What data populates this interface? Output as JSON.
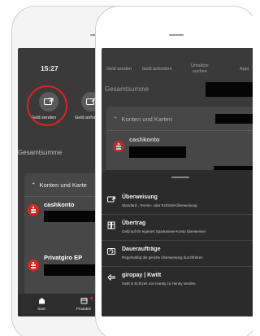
{
  "left_phone": {
    "time": "15:27",
    "actions": [
      {
        "label": "Geld senden",
        "icon": "send-money-icon"
      },
      {
        "label": "Geld anfor",
        "icon": "request-money-icon"
      }
    ],
    "total_label": "Gesamtsumme",
    "accounts_header": "Konten und Karte",
    "accounts": [
      {
        "name": "cashkonto"
      },
      {
        "name": "Privatgiro EP"
      }
    ],
    "tabs": [
      {
        "label": "Start",
        "icon": "home-icon"
      },
      {
        "label": "Produkte",
        "icon": "products-icon"
      }
    ],
    "highlight_color": "#e2231a"
  },
  "right_phone": {
    "top_nav": [
      {
        "label": "Geld senden"
      },
      {
        "label": "Geld anfordern"
      },
      {
        "label": "Umsätze\nsuchen"
      },
      {
        "label": "Appl"
      }
    ],
    "total_label": "Gesamtsumme",
    "accounts_header": "Konten und Karten",
    "accounts": [
      {
        "name": "cashkonto"
      }
    ],
    "sheet": {
      "items": [
        {
          "title": "Überweisung",
          "subtitle": "Standard-, Termin- oder Echtzeit-Überweisung",
          "icon": "transfer-icon"
        },
        {
          "title": "Übertrag",
          "subtitle": "Geld auf Ihr eigenes Sparkassen-Konto überweisen",
          "icon": "internal-transfer-icon"
        },
        {
          "title": "Daueraufträge",
          "subtitle": "Regelmäßig die gleiche Überweisung durchführen",
          "icon": "standing-order-icon"
        },
        {
          "title": "giropay | Kwitt",
          "subtitle": "Geld in Echtzeit von Handy zu Handy senden",
          "icon": "giropay-kwitt-icon"
        }
      ]
    }
  },
  "colors": {
    "brand_red": "#e2231a",
    "screen_bg": "#3a3a3a",
    "sheet_bg": "#2b2b2b"
  }
}
